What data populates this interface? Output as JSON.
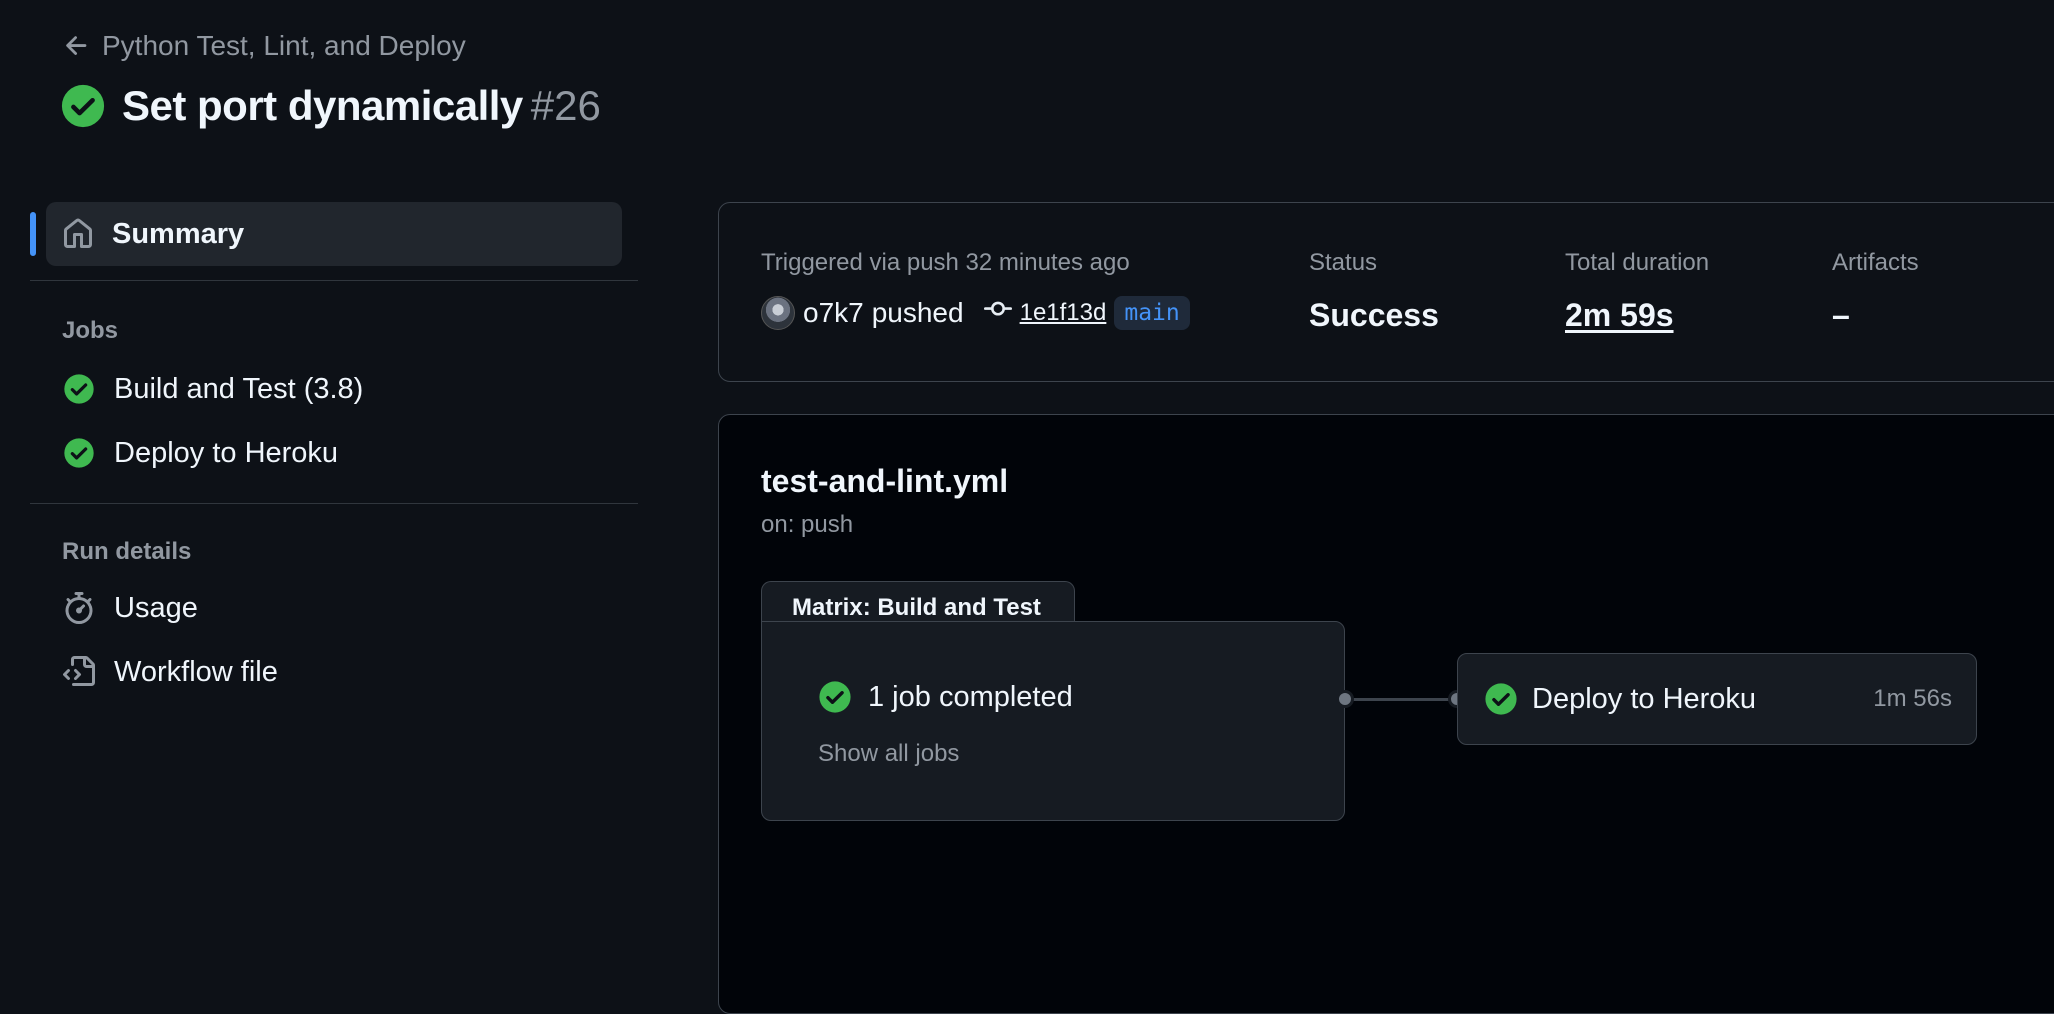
{
  "header": {
    "back_label": "Python Test, Lint, and Deploy",
    "run_title": "Set port dynamically",
    "run_number": "#26",
    "status_color": "#3fb950"
  },
  "sidebar": {
    "summary_label": "Summary",
    "jobs_section": "Jobs",
    "jobs": [
      {
        "label": "Build and Test (3.8)",
        "status": "success"
      },
      {
        "label": "Deploy to Heroku",
        "status": "success"
      }
    ],
    "run_details_section": "Run details",
    "details": [
      {
        "label": "Usage",
        "icon": "stopwatch-icon"
      },
      {
        "label": "Workflow file",
        "icon": "file-code-icon"
      }
    ]
  },
  "summary": {
    "trigger_text": "Triggered via push 32 minutes ago",
    "actor": "o7k7",
    "action": "pushed",
    "commit_sha": "1e1f13d",
    "branch": "main",
    "status_label": "Status",
    "status_value": "Success",
    "duration_label": "Total duration",
    "duration_value": "2m 59s",
    "artifacts_label": "Artifacts",
    "artifacts_value": "–"
  },
  "workflow": {
    "file_name": "test-and-lint.yml",
    "trigger": "on: push",
    "matrix_title": "Matrix: Build and Test",
    "matrix_status": "1 job completed",
    "show_all_label": "Show all jobs",
    "deploy_job_name": "Deploy to Heroku",
    "deploy_job_duration": "1m 56s"
  }
}
